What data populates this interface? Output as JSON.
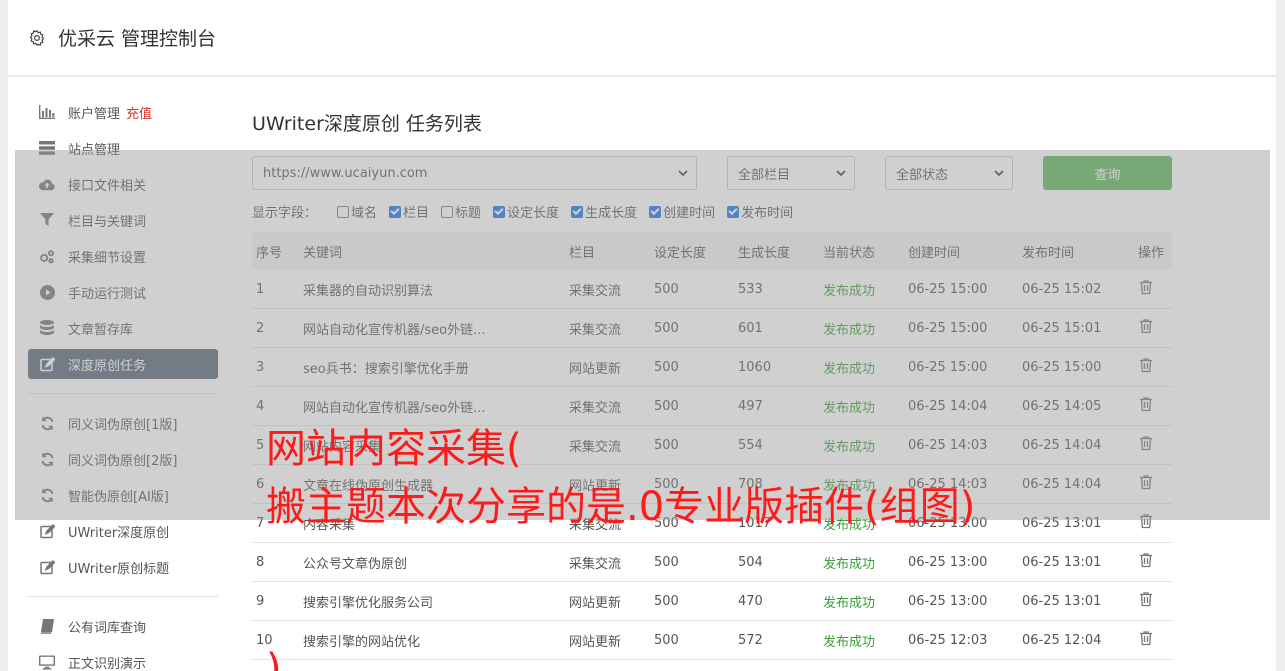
{
  "header": {
    "title": "优采云 管理控制台"
  },
  "sidebar": {
    "items": [
      {
        "label": "账户管理",
        "badge": "充值",
        "icon": "bar-chart-icon"
      },
      {
        "label": "站点管理",
        "icon": "server-icon"
      },
      {
        "label": "接口文件相关",
        "icon": "cloud-upload-icon"
      },
      {
        "label": "栏目与关键词",
        "icon": "filter-icon"
      },
      {
        "label": "采集细节设置",
        "icon": "cogs-icon"
      },
      {
        "label": "手动运行测试",
        "icon": "play-icon"
      },
      {
        "label": "文章暂存库",
        "icon": "database-icon"
      },
      {
        "label": "深度原创任务",
        "icon": "edit-icon"
      },
      {
        "label": "同义词伪原创[1版]",
        "icon": "refresh-icon"
      },
      {
        "label": "同义词伪原创[2版]",
        "icon": "refresh-icon"
      },
      {
        "label": "智能伪原创[AI版]",
        "icon": "refresh-icon"
      },
      {
        "label": "UWriter深度原创",
        "icon": "edit-icon"
      },
      {
        "label": "UWriter原创标题",
        "icon": "edit-icon"
      },
      {
        "label": "公有词库查询",
        "icon": "book-icon"
      },
      {
        "label": "正文识别演示",
        "icon": "monitor-icon"
      }
    ]
  },
  "main": {
    "title": "UWriter深度原创 任务列表",
    "filters": {
      "site": "https://www.ucaiyun.com",
      "category": "全部栏目",
      "status": "全部状态",
      "query_label": "查询"
    },
    "fields_label": "显示字段：",
    "fields": [
      {
        "label": "域名",
        "checked": false
      },
      {
        "label": "栏目",
        "checked": true
      },
      {
        "label": "标题",
        "checked": false
      },
      {
        "label": "设定长度",
        "checked": true
      },
      {
        "label": "生成长度",
        "checked": true
      },
      {
        "label": "创建时间",
        "checked": true
      },
      {
        "label": "发布时间",
        "checked": true
      }
    ],
    "table": {
      "headers": [
        "序号",
        "关键词",
        "栏目",
        "设定长度",
        "生成长度",
        "当前状态",
        "创建时间",
        "发布时间",
        "操作"
      ],
      "rows": [
        [
          "1",
          "采集器的自动识别算法",
          "采集交流",
          "500",
          "533",
          "发布成功",
          "06-25 15:00",
          "06-25 15:02"
        ],
        [
          "2",
          "网站自动化宣传机器/seo外链...",
          "采集交流",
          "500",
          "601",
          "发布成功",
          "06-25 15:00",
          "06-25 15:01"
        ],
        [
          "3",
          "seo兵书：搜索引擎优化手册",
          "网站更新",
          "500",
          "1060",
          "发布成功",
          "06-25 15:00",
          "06-25 15:00"
        ],
        [
          "4",
          "网站自动化宣传机器/seo外链...",
          "采集交流",
          "500",
          "497",
          "发布成功",
          "06-25 14:04",
          "06-25 14:05"
        ],
        [
          "5",
          "网站内容采集",
          "采集交流",
          "500",
          "554",
          "发布成功",
          "06-25 14:03",
          "06-25 14:04"
        ],
        [
          "6",
          "文章在线伪原创生成器",
          "网站更新",
          "500",
          "708",
          "发布成功",
          "06-25 14:03",
          "06-25 14:04"
        ],
        [
          "7",
          "内容采集",
          "采集交流",
          "500",
          "1017",
          "发布成功",
          "06-25 13:00",
          "06-25 13:01"
        ],
        [
          "8",
          "公众号文章伪原创",
          "采集交流",
          "500",
          "504",
          "发布成功",
          "06-25 13:00",
          "06-25 13:01"
        ],
        [
          "9",
          "搜索引擎优化服务公司",
          "网站更新",
          "500",
          "470",
          "发布成功",
          "06-25 13:00",
          "06-25 13:01"
        ],
        [
          "10",
          "搜索引擎的网站优化",
          "网站更新",
          "500",
          "572",
          "发布成功",
          "06-25 12:03",
          "06-25 12:04"
        ]
      ]
    }
  },
  "overlay": {
    "line1": "网站内容采集(",
    "line2": "搬主题本次分享的是.0专业版插件(组图)",
    "line3": ")"
  }
}
